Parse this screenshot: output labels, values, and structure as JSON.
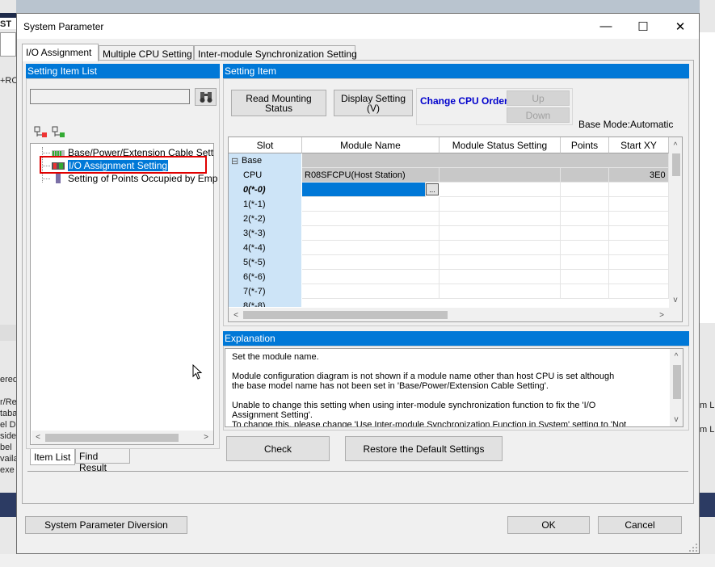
{
  "background": {
    "fragments": [
      "ST",
      "+RC",
      "ered",
      "r/Re",
      "taba",
      "el D",
      "side",
      "bel",
      "vaila",
      "exe",
      "m L",
      "m L"
    ]
  },
  "dialog": {
    "title": "System Parameter",
    "controls": {
      "minimize": "—",
      "maximize": "☐",
      "close": "✕"
    },
    "tabs": [
      {
        "label": "I/O Assignment",
        "active": true
      },
      {
        "label": "Multiple CPU Setting",
        "active": false
      },
      {
        "label": "Inter-module Synchronization Setting",
        "active": false
      }
    ]
  },
  "left_panel": {
    "header": "Setting Item List",
    "search_value": "",
    "tree_items": [
      {
        "label": "Base/Power/Extension Cable Sett",
        "icon": "module-rack-icon"
      },
      {
        "label": "I/O Assignment Setting",
        "icon": "io-assignment-icon",
        "selected": true
      },
      {
        "label": "Setting of Points Occupied by Emp",
        "icon": "empty-slot-icon"
      }
    ],
    "bottom_tabs": [
      {
        "label": "Item List",
        "active": true
      },
      {
        "label": "Find Result",
        "active": false
      }
    ]
  },
  "right_panel": {
    "header": "Setting Item",
    "buttons": {
      "read_mounting": "Read Mounting\nStatus",
      "display_setting": "Display Setting\n(V)",
      "change_cpu_order": "Change CPU Order",
      "up": "Up",
      "down": "Down"
    },
    "base_mode": "Base Mode:Automatic",
    "columns": [
      "Slot",
      "Module Name",
      "Module Status Setting",
      "Points",
      "Start XY"
    ],
    "rows": [
      {
        "slot": "Base",
        "expander": "⊟",
        "module": "",
        "status": "",
        "points": "",
        "start": ""
      },
      {
        "slot": "CPU",
        "module": "R08SFCPU(Host Station)",
        "status": "",
        "points": "",
        "start": "3E0"
      },
      {
        "slot": "0(*-0)",
        "module": "",
        "selected": true
      },
      {
        "slot": "1(*-1)"
      },
      {
        "slot": "2(*-2)"
      },
      {
        "slot": "3(*-3)"
      },
      {
        "slot": "4(*-4)"
      },
      {
        "slot": "5(*-5)"
      },
      {
        "slot": "6(*-6)"
      },
      {
        "slot": "7(*-7)"
      },
      {
        "slot": "8(*-8)"
      }
    ],
    "browse_button": "...",
    "explanation_header": "Explanation",
    "explanation_lines": [
      "Set the module name.",
      "",
      "Module configuration diagram is not shown if a module name other than host CPU is set although",
      "the base model name has not been set in 'Base/Power/Extension Cable Setting'.",
      "",
      "Unable to change this setting when using inter-module synchronization function to fix the 'I/O",
      "Assignment Setting'.",
      "To change this, please change 'Use Inter-module Synchronization Function in System' setting to 'Not"
    ],
    "check_button": "Check",
    "restore_button": "Restore the Default Settings"
  },
  "footer": {
    "diversion_button": "System Parameter Diversion",
    "ok_button": "OK",
    "cancel_button": "Cancel"
  },
  "colors": {
    "header_blue": "#0078d7",
    "slot_column": "#cde4f7",
    "selection_blue": "#0078d7",
    "cpu_row_gray": "#c8c8c8",
    "change_cpu_text": "#0000cc",
    "highlight_red": "#e00000"
  }
}
